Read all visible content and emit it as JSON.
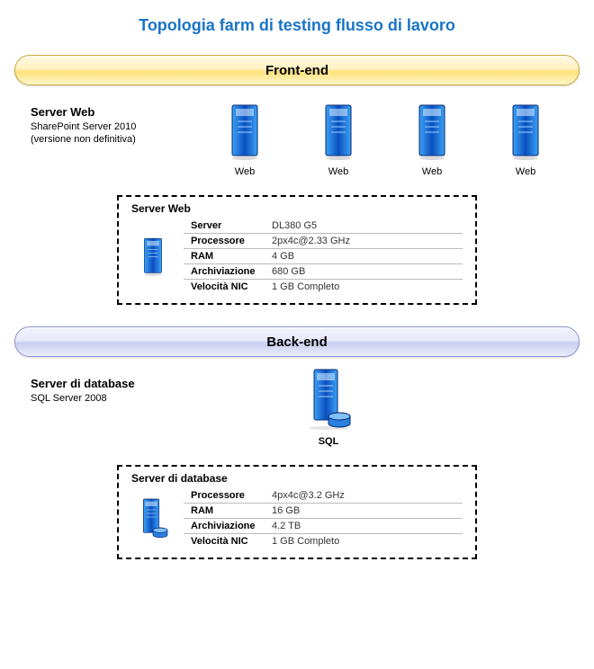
{
  "title": "Topologia farm di testing flusso di lavoro",
  "frontend": {
    "bar_label": "Front-end",
    "heading": "Server Web",
    "sub1": "SharePoint Server 2010",
    "sub2": "(versione non definitiva)",
    "server_labels": [
      "Web",
      "Web",
      "Web",
      "Web"
    ],
    "spec": {
      "title": "Server Web",
      "rows": [
        {
          "k": "Server",
          "v": "DL380 G5"
        },
        {
          "k": "Processore",
          "v": "2px4c@2.33 GHz"
        },
        {
          "k": "RAM",
          "v": "4 GB"
        },
        {
          "k": "Archiviazione",
          "v": "680 GB"
        },
        {
          "k": "Velocità NIC",
          "v": "1 GB Completo"
        }
      ]
    }
  },
  "backend": {
    "bar_label": "Back-end",
    "heading": "Server di database",
    "sub1": "SQL Server 2008",
    "server_label": "SQL",
    "spec": {
      "title": "Server di database",
      "rows": [
        {
          "k": "Processore",
          "v": "4px4c@3.2 GHz"
        },
        {
          "k": "RAM",
          "v": "16 GB"
        },
        {
          "k": "Archiviazione",
          "v": "4.2 TB"
        },
        {
          "k": "Velocità NIC",
          "v": "1 GB Completo"
        }
      ]
    }
  }
}
